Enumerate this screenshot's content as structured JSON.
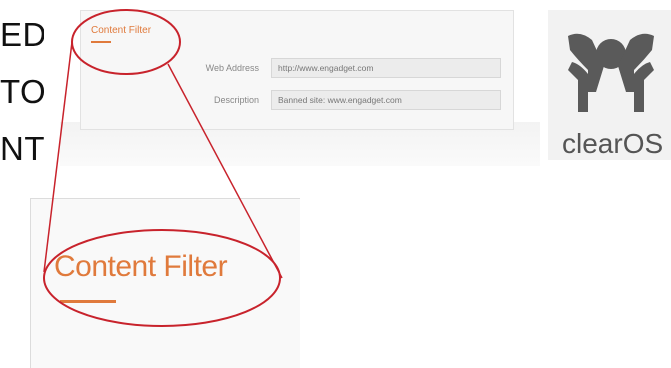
{
  "slide_text": [
    "ED",
    "TO",
    "NT"
  ],
  "panel": {
    "title": "Content Filter",
    "fields": [
      {
        "label": "Web Address",
        "value": "http://www.engadget.com"
      },
      {
        "label": "Description",
        "value": "Banned site: www.engadget.com"
      }
    ]
  },
  "zoom": {
    "title": "Content Filter"
  },
  "logo": {
    "text": "clearOS"
  },
  "colors": {
    "accent": "#e07a3c",
    "annotation": "#c8232c",
    "logo_gray": "#5a5a5a"
  }
}
